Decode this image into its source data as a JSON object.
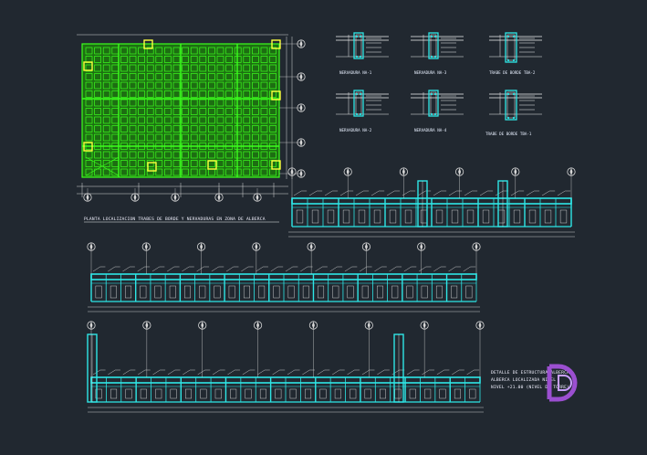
{
  "drawing": {
    "plan_title": "PLANTA LOCALIZACION TRABES DE BORDE Y NERVADURAS EN ZONA DE ALBERCA",
    "detail_title_lines": [
      "DETALLE DE ESTRUCTURA ALBERCA",
      "ALBERCA LOCALIZADA NIVEL",
      "NIVEL +21.00 (NIVEL DE TORRE)"
    ],
    "sections": [
      {
        "label": "NERVADURA NA-1"
      },
      {
        "label": "NERVADURA NA-3"
      },
      {
        "label": "TRABE DE BORDE TBA-2"
      },
      {
        "label": "NERVADURA NA-2"
      },
      {
        "label": "NERVADURA NA-4"
      },
      {
        "label": "TRABE DE BORDE TBA-1"
      }
    ]
  },
  "colors": {
    "background": "#212830",
    "plan": "#3cff1e",
    "plan_fill": "#22a810",
    "column": "#ffff3c",
    "structure": "#2ee6e6",
    "axis": "#d8d8d8",
    "white": "#f0f0f0",
    "logo": "#9b4fd0"
  }
}
